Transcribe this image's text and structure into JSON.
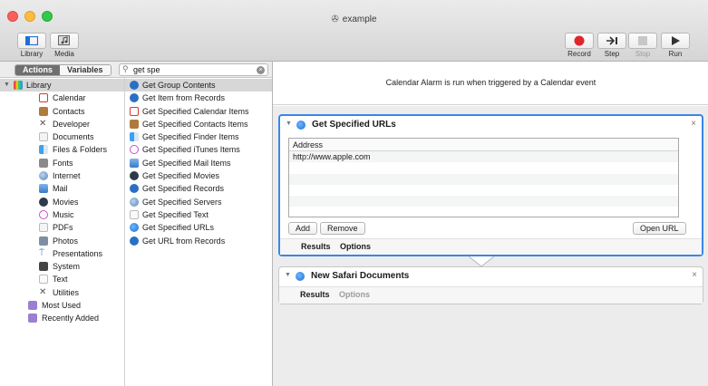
{
  "window": {
    "title": "example"
  },
  "toolbar": {
    "library_label": "Library",
    "media_label": "Media",
    "record_label": "Record",
    "step_label": "Step",
    "stop_label": "Stop",
    "run_label": "Run",
    "colors": {
      "record": "#e0262b"
    }
  },
  "library_panel": {
    "actions_tab": "Actions",
    "variables_tab": "Variables",
    "search": {
      "value": "get spe"
    },
    "categories": [
      {
        "label": "Library",
        "icon": "library-icon"
      },
      {
        "label": "Calendar",
        "icon": "calendar-icon"
      },
      {
        "label": "Contacts",
        "icon": "contacts-icon"
      },
      {
        "label": "Developer",
        "icon": "developer-icon"
      },
      {
        "label": "Documents",
        "icon": "documents-icon"
      },
      {
        "label": "Files & Folders",
        "icon": "finder-icon"
      },
      {
        "label": "Fonts",
        "icon": "fonts-icon"
      },
      {
        "label": "Internet",
        "icon": "internet-icon"
      },
      {
        "label": "Mail",
        "icon": "mail-icon"
      },
      {
        "label": "Movies",
        "icon": "movies-icon"
      },
      {
        "label": "Music",
        "icon": "music-icon"
      },
      {
        "label": "PDFs",
        "icon": "pdf-icon"
      },
      {
        "label": "Photos",
        "icon": "photos-icon"
      },
      {
        "label": "Presentations",
        "icon": "presentations-icon"
      },
      {
        "label": "System",
        "icon": "system-icon"
      },
      {
        "label": "Text",
        "icon": "text-icon"
      },
      {
        "label": "Utilities",
        "icon": "utilities-icon"
      },
      {
        "label": "Most Used",
        "icon": "folder-icon"
      },
      {
        "label": "Recently Added",
        "icon": "folder-icon"
      }
    ],
    "actions": [
      "Get Group Contents",
      "Get Item from Records",
      "Get Specified Calendar Items",
      "Get Specified Contacts Items",
      "Get Specified Finder Items",
      "Get Specified iTunes Items",
      "Get Specified Mail Items",
      "Get Specified Movies",
      "Get Specified Records",
      "Get Specified Servers",
      "Get Specified Text",
      "Get Specified URLs",
      "Get URL from Records"
    ]
  },
  "workflow": {
    "info_text": "Calendar Alarm is run when triggered by a Calendar event",
    "actions": [
      {
        "title": "Get Specified URLs",
        "column_header": "Address",
        "rows": [
          "http://www.apple.com"
        ],
        "add_label": "Add",
        "remove_label": "Remove",
        "open_label": "Open URL",
        "results_tab": "Results",
        "options_tab": "Options"
      },
      {
        "title": "New Safari Documents",
        "results_tab": "Results",
        "options_tab": "Options"
      }
    ],
    "colors": {
      "selected_border": "#3b86e6"
    }
  }
}
